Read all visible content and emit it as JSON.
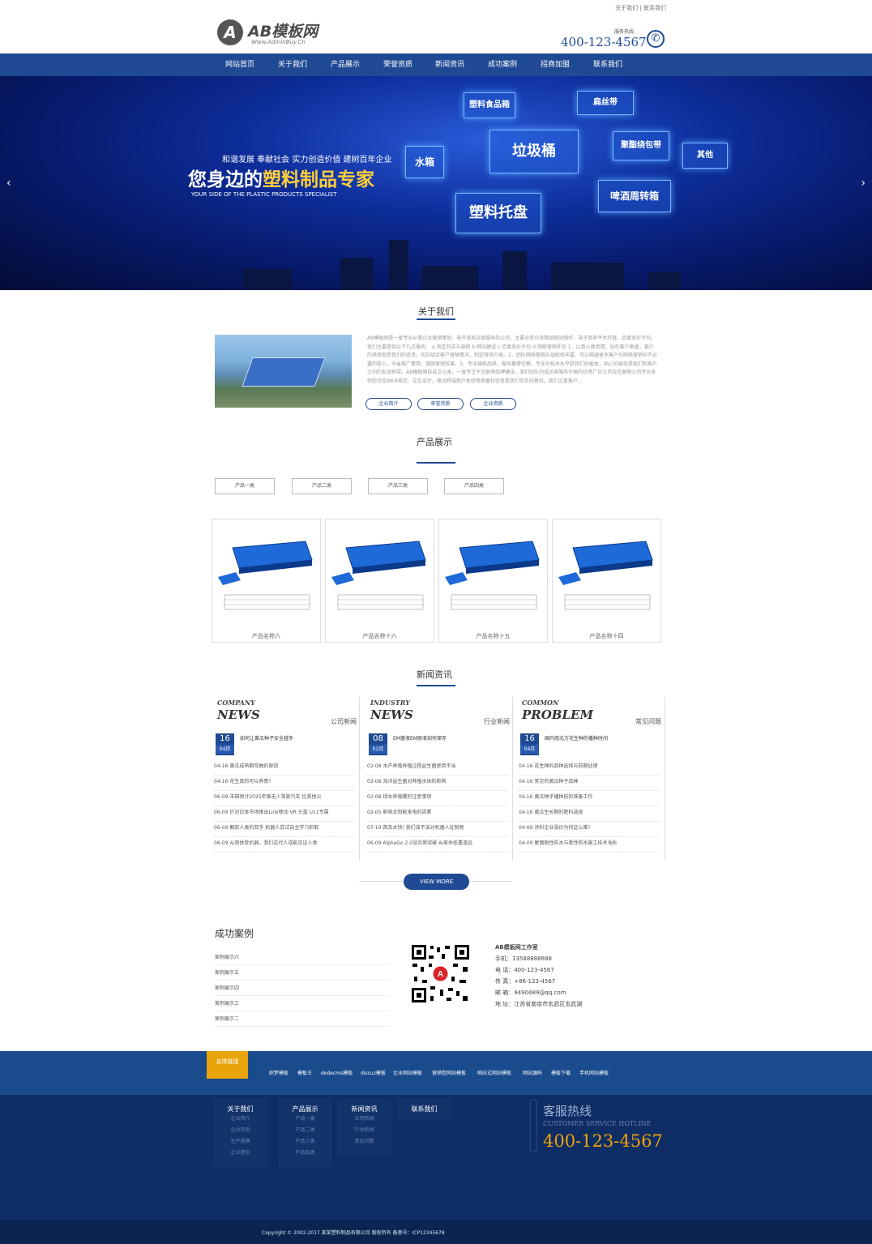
{
  "header": {
    "top_links": "关于我们 | 联系我们",
    "logo_text": "AB模板网",
    "logo_sub": "Www.AdminBuy.Cn",
    "logo_letter": "A",
    "hotline_label": "服务热线",
    "hotline": "400-123-4567"
  },
  "nav": [
    "网站首页",
    "关于我们",
    "产品展示",
    "荣誉资质",
    "新闻资讯",
    "成功案例",
    "招商加盟",
    "联系我们"
  ],
  "banner": {
    "sub": "和谐发展 奉献社会 实力创造价值 建树百年企业",
    "title_a": "您身边的",
    "title_b": "塑料制品专家",
    "en": "YOUR SIDE OF THE PLASTIC PRODUCTS SPECIALIST",
    "boxes": [
      "塑料食品箱",
      "扁丝带",
      "垃圾桶",
      "聚酯绕包带",
      "其他",
      "水箱",
      "啤酒周转箱",
      "塑料托盘"
    ],
    "prev": "‹",
    "next": "›"
  },
  "about": {
    "title": "关于我们",
    "text": "AB模板网是一家专业从事企业营销策划、电子商务运营服务的公司，主要业务包含精品网站制作、电子商务平台托管、百度竞价外包。我们主要提供以下几点服务： a 淘宝开店与装修 b 网站建设 c 百度竞价外包 d 网络营销外包 1、以真心换真情，站在客户角度，客户的满意就是我们的追求，切实结合客户营销情况，制定营销方案。2、团队网络营销实战经验丰富，可以规避很多客户在网络营销中不必要的投入，节省推广费用，增强营销效果。3、专业铸就品质，服务赢得信赖，专业的技术水平是我们的根本，贴心的服务是我们和客户之间的友谊桥梁。AB模板网自成立以来，一直专注于互联网品牌建设，我们团队的成员曾服务于国内优秀广告公司及互联网公司专业条例型涉及WEB规范、交互设计、移动终端用户体验等质量和信誉是我们存在的基石。我们注重客户...",
    "buttons": [
      "企业简介",
      "荣誉资质",
      "企业资质"
    ]
  },
  "products": {
    "title": "产品展示",
    "categories": [
      "产品一类",
      "产品二类",
      "产品三类",
      "产品四类"
    ],
    "items": [
      "产品名称六",
      "产品名称十六",
      "产品名称十五",
      "产品名称十四"
    ]
  },
  "news": {
    "title": "新闻资讯",
    "columns": [
      {
        "en1": "COMPANY",
        "en2": "NEWS",
        "cn": "公司新闻",
        "day": "16",
        "month": "04月",
        "headline": "如何让黄瓜种子安全越冬",
        "rows": [
          "04-16  黄瓜成熟期弯曲的原因",
          "04-16  花生真的可以养胃?",
          "06-09  丰田预计2025年推无人驾驶汽车 比其他公",
          "06-09  针对日本市场推出Link移动 VR 头盔 U11专属",
          "06-09  解放人类的双手 机器人尝试自主学习抓取",
          "06-09  从肉体变机器，我们这代人或能见证人类"
        ]
      },
      {
        "en1": "INDUSTRY",
        "en2": "NEWS",
        "cn": "行业新闻",
        "day": "08",
        "month": "02月",
        "headline": "EM菌液EM原液如何保存",
        "rows": [
          "02-08  水产养殖养殖过程益生菌使用不当",
          "02-08  海洋益生菌对养殖水体的影响",
          "02-08  绿水养殖螺的注意事项",
          "02-05  影响太阳能发电的因素",
          "07-10  首及太快! 我们该不该对机器人征税呢",
          "06-09  AlphaGo 2.0没实质突破 AI革命任重道远"
        ]
      },
      {
        "en1": "COMMON",
        "en2": "PROBLEM",
        "cn": "常见问题",
        "day": "16",
        "month": "04月",
        "headline": "国内南北方花生种的播种时间",
        "rows": [
          "04-16  花生种的品种选择与前期处理",
          "04-16  常见的黄瓜种子品种",
          "04-16  黄瓜种子播种前的准备工作",
          "04-16  黄瓜生长期的肥料选择",
          "04-09  涂料企业涨价为何这么难?",
          "04-09  屋面刚性防水与柔性防水施工技术浅析"
        ]
      }
    ],
    "view_more": "VIEW MORE"
  },
  "cases": {
    "title": "成功案例",
    "items": [
      "案例展示六",
      "案例展示五",
      "案例展示四",
      "案例展示三",
      "案例展示二"
    ]
  },
  "contact": {
    "title": "AB模板网工作室",
    "lines": [
      "手机：13588888888",
      "电 话：400-123-4567",
      "传 真：+86-123-4567",
      "邮 箱：9490489@qq.com",
      "地 址：江苏省南京市玄武区玄武湖"
    ]
  },
  "friend_links": {
    "tag": "友情链接",
    "items": [
      "织梦模板",
      "模板王",
      "dedecms模板",
      "discuz模板",
      "企业网站模板",
      "营销型网站模板",
      "响应式网站模板",
      "网站源码",
      "模板下载",
      "手机网站模板"
    ]
  },
  "footer": {
    "cols": [
      {
        "head": "关于我们",
        "items": [
          "企业简介",
          "企业资质",
          "生产规模",
          "企业理念"
        ]
      },
      {
        "head": "产品展示",
        "items": [
          "产品一类",
          "产品二类",
          "产品三类",
          "产品四类"
        ]
      },
      {
        "head": "新闻资讯",
        "items": [
          "公司新闻",
          "行业新闻",
          "常见问题"
        ]
      },
      {
        "head": "联系我们",
        "items": []
      }
    ],
    "hot_cn": "客服热线",
    "hot_en": "CUSTOMER SERVICE HOTLINE",
    "hot_no": "400-123-4567",
    "copyright": "Copyright © 2002-2017 某某塑料制品有限公司 版权所有 备案号：ICP12345678"
  },
  "colors": {
    "primary": "#1f4a93",
    "accent": "#e8a40a",
    "footer": "#0e2d64"
  }
}
